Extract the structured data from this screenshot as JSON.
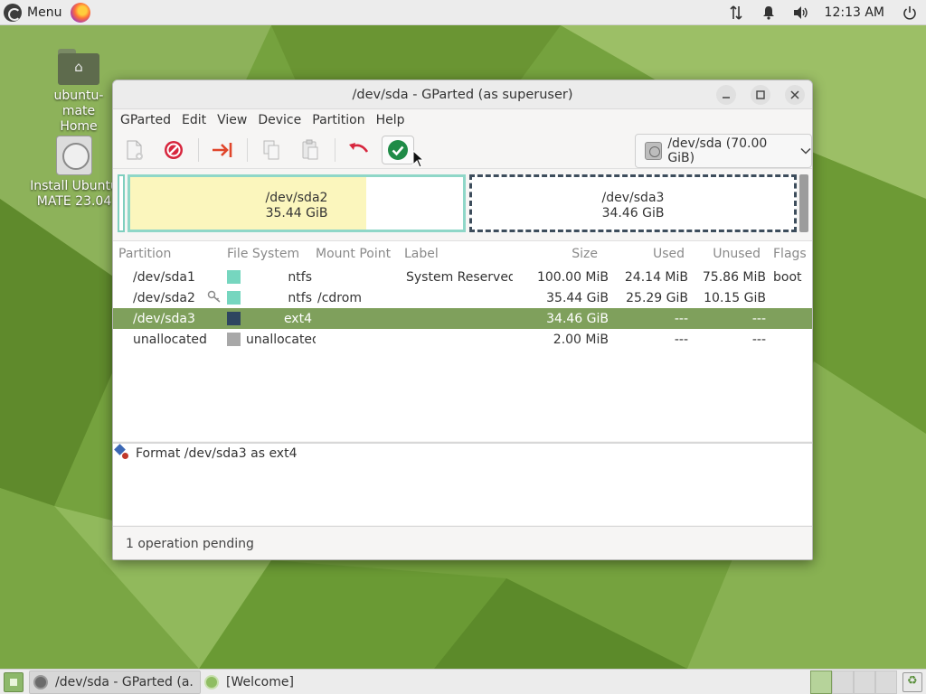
{
  "top_panel": {
    "menu_label": "Menu",
    "clock": "12:13 AM"
  },
  "desktop": {
    "icons": [
      {
        "caption": "ubuntu-mate Home"
      },
      {
        "caption": "Install Ubuntu MATE 23.04"
      }
    ]
  },
  "window": {
    "title": "/dev/sda - GParted (as superuser)",
    "menu": [
      "GParted",
      "Edit",
      "View",
      "Device",
      "Partition",
      "Help"
    ],
    "device_selector": "/dev/sda (70.00 GiB)"
  },
  "partition_map": {
    "sda2": {
      "name": "/dev/sda2",
      "size": "35.44 GiB",
      "used_fraction": 0.71
    },
    "sda3": {
      "name": "/dev/sda3",
      "size": "34.46 GiB"
    }
  },
  "table": {
    "headers": [
      "Partition",
      "File System",
      "Mount Point",
      "Label",
      "Size",
      "Used",
      "Unused",
      "Flags"
    ],
    "rows": [
      {
        "partition": "/dev/sda1",
        "fs": "ntfs",
        "fs_color": "#76d6bf",
        "mount": "",
        "label": "System Reserved",
        "size": "100.00 MiB",
        "used": "24.14 MiB",
        "unused": "75.86 MiB",
        "flags": "boot"
      },
      {
        "partition": "/dev/sda2",
        "fs": "ntfs",
        "fs_color": "#76d6bf",
        "mount": "/cdrom",
        "label": "",
        "size": "35.44 GiB",
        "used": "25.29 GiB",
        "unused": "10.15 GiB",
        "flags": ""
      },
      {
        "partition": "/dev/sda3",
        "fs": "ext4",
        "fs_color": "#2e4560",
        "mount": "",
        "label": "",
        "size": "34.46 GiB",
        "used": "---",
        "unused": "---",
        "flags": ""
      },
      {
        "partition": "unallocated",
        "fs": "unallocated",
        "fs_color": "#a8a8a8",
        "mount": "",
        "label": "",
        "size": "2.00 MiB",
        "used": "---",
        "unused": "---",
        "flags": ""
      }
    ]
  },
  "operations": [
    "Format /dev/sda3 as ext4"
  ],
  "status": "1 operation pending",
  "taskbar": {
    "tasks": [
      "/dev/sda - GParted (a...",
      "[Welcome]"
    ]
  },
  "colors": {
    "selection": "#7fa05c",
    "ntfs": "#76d6bf",
    "ext4": "#2e4560",
    "unallocated": "#a8a8a8"
  }
}
